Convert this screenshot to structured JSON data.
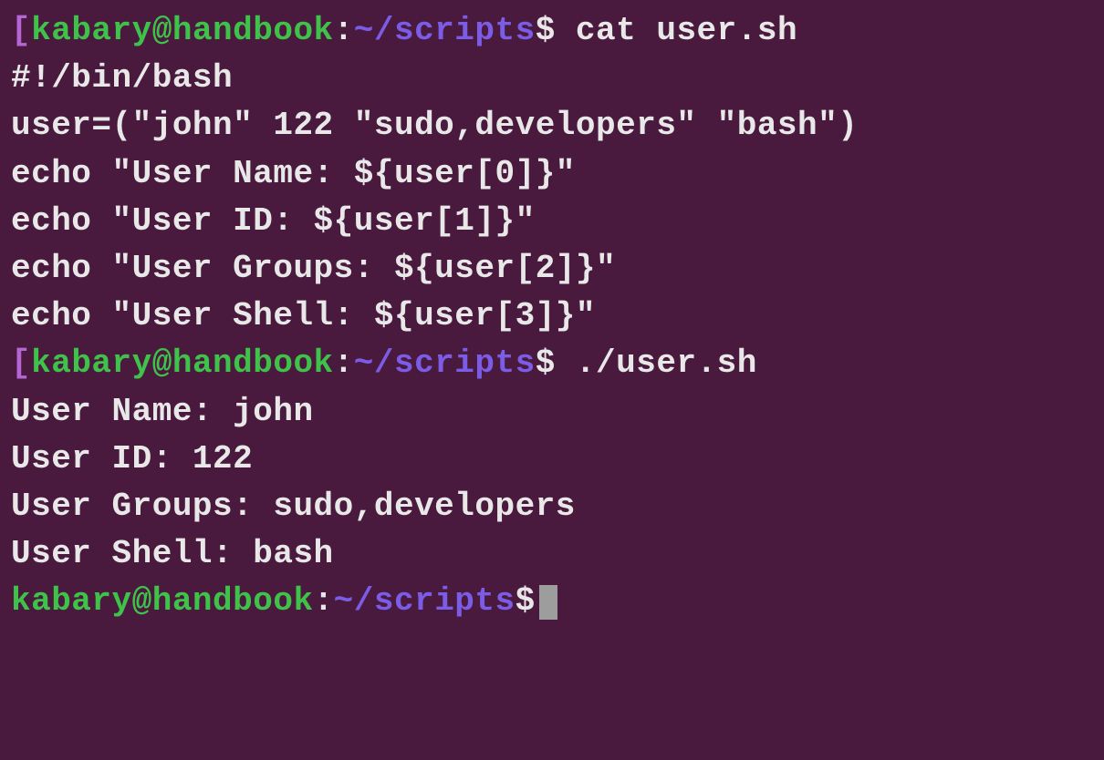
{
  "colors": {
    "background": "#4a1a3e",
    "text": "#e8e8e8",
    "bracket": "#b565d4",
    "user_host": "#3fc24a",
    "path": "#7b5ce6",
    "cursor": "#9d9d9d"
  },
  "prompt": {
    "bracket": "[",
    "user_host": "kabary@handbook",
    "colon": ":",
    "path": "~/scripts",
    "dollar": "$"
  },
  "session": {
    "cmd1": " cat user.sh",
    "script_lines": [
      "#!/bin/bash",
      "",
      "user=(\"john\" 122 \"sudo,developers\" \"bash\")",
      "",
      "echo \"User Name: ${user[0]}\"",
      "echo \"User ID: ${user[1]}\"",
      "echo \"User Groups: ${user[2]}\"",
      "echo \"User Shell: ${user[3]}\""
    ],
    "cmd2": " ./user.sh",
    "output_lines": [
      "User Name: john",
      "User ID: 122",
      "User Groups: sudo,developers",
      "User Shell: bash"
    ]
  }
}
